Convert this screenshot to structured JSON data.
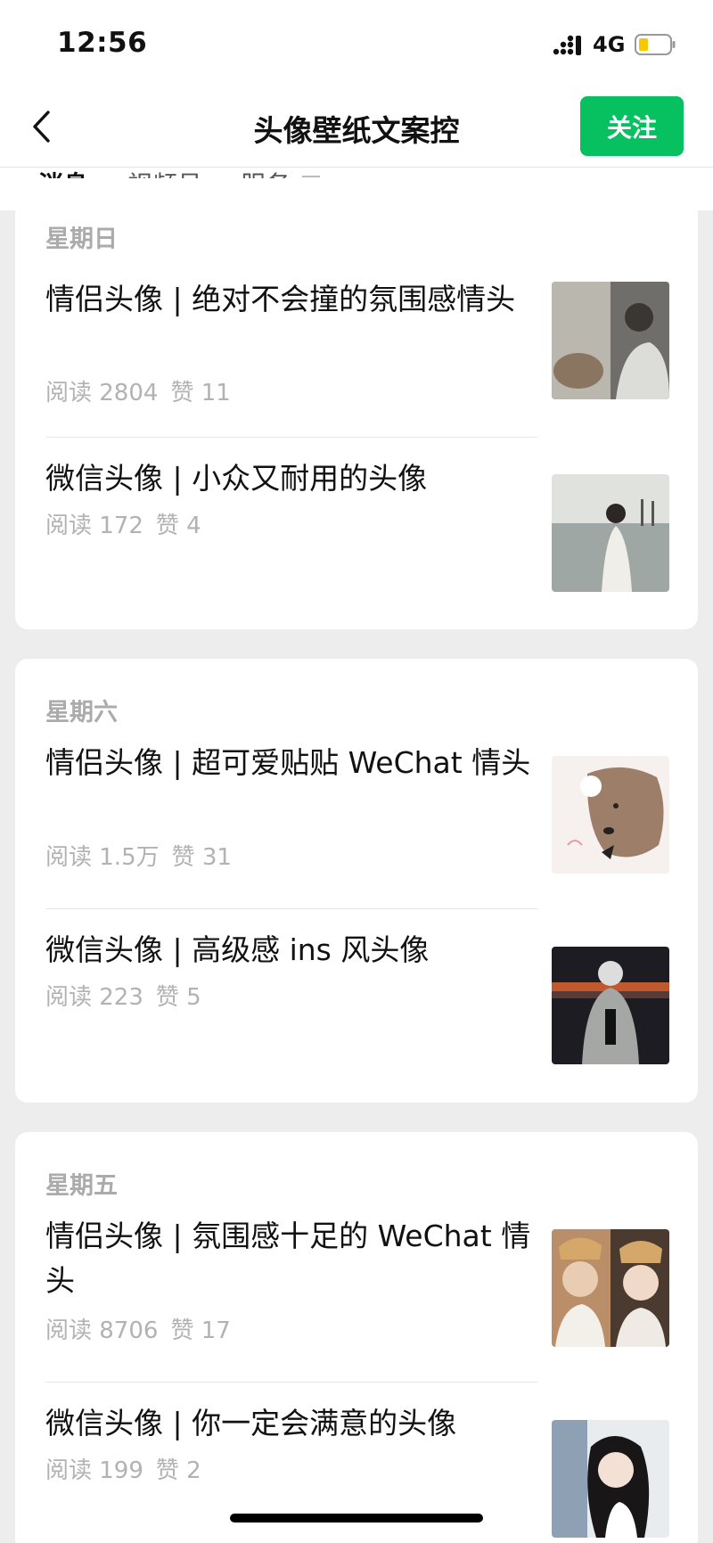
{
  "status": {
    "time": "12:56",
    "network": "4G"
  },
  "nav": {
    "title": "头像壁纸文案控",
    "follow_label": "关注"
  },
  "tabs": [
    {
      "label": "消息"
    },
    {
      "label": "视频号"
    },
    {
      "label": "服务"
    }
  ],
  "groups": [
    {
      "day": "星期日",
      "articles": [
        {
          "title": "情侣头像 | 绝对不会撞的氛围感情头",
          "reads": "阅读 2804",
          "likes": "赞 11",
          "thumb": "couple-car-photo"
        },
        {
          "title": "微信头像 | 小众又耐用的头像",
          "reads": "阅读 172",
          "likes": "赞 4",
          "thumb": "girl-beach-photo"
        }
      ]
    },
    {
      "day": "星期六",
      "articles": [
        {
          "title": "情侣头像 | 超可爱贴贴 WeChat 情头",
          "reads": "阅读 1.5万",
          "likes": "赞 31",
          "thumb": "cartoon-dog-photo"
        },
        {
          "title": "微信头像 | 高级感 ins 风头像",
          "reads": "阅读 223",
          "likes": "赞 5",
          "thumb": "sunset-hoodie-photo"
        }
      ]
    },
    {
      "day": "星期五",
      "articles": [
        {
          "title": "情侣头像 | 氛围感十足的 WeChat 情头",
          "reads": "阅读 8706",
          "likes": "赞 17",
          "thumb": "couple-hats-photo"
        },
        {
          "title": "微信头像 | 你一定会满意的头像",
          "reads": "阅读 199",
          "likes": "赞 2",
          "thumb": "girl-selfie-photo"
        }
      ]
    }
  ],
  "colors": {
    "accent": "#07c160",
    "meta": "#b2b2b2",
    "background": "#ededed"
  }
}
